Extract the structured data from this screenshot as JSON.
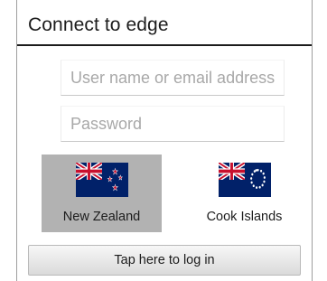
{
  "dialog": {
    "title": "Connect to edge"
  },
  "form": {
    "username_placeholder": "User name or email address",
    "username_value": "",
    "password_placeholder": "Password",
    "password_value": ""
  },
  "regions": [
    {
      "label": "New Zealand",
      "flag_icon": "new-zealand-flag-icon",
      "selected": true
    },
    {
      "label": "Cook Islands",
      "flag_icon": "cook-islands-flag-icon",
      "selected": false
    }
  ],
  "login_button": {
    "label": "Tap here to log in"
  },
  "colors": {
    "selected_region_bg": "#b2b2b2",
    "flag_blue": "#012169",
    "flag_red": "#c8102e"
  }
}
